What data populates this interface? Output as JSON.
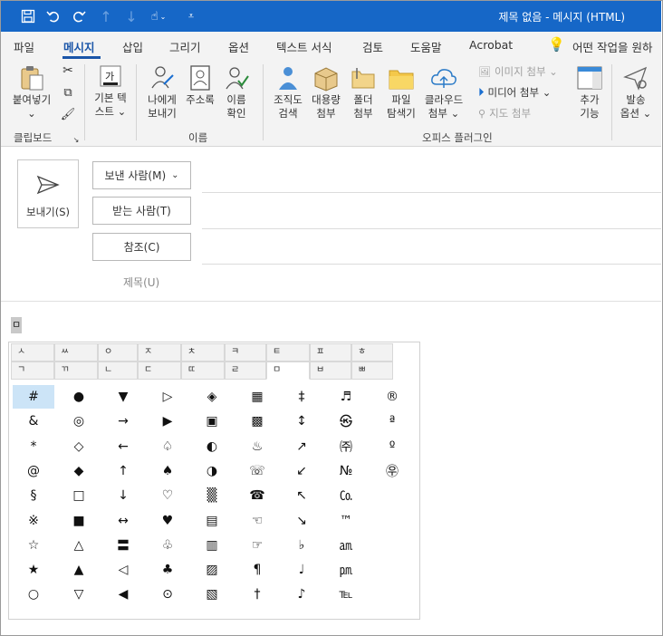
{
  "titlebar": {
    "title": "제목 없음  -  메시지 (HTML)",
    "icons": [
      "save-icon",
      "undo-icon",
      "redo-icon",
      "up-arrow-icon",
      "down-arrow-icon",
      "touch-mode-icon",
      "customize-quick-access-icon"
    ]
  },
  "tabs": [
    "파일",
    "메시지",
    "삽입",
    "그리기",
    "옵션",
    "텍스트 서식",
    "검토",
    "도움말",
    "Acrobat",
    "어떤 작업을 원하"
  ],
  "active_tab": "메시지",
  "ribbon": {
    "paste": {
      "line1": "붙여넣기",
      "line2": "⌄"
    },
    "clipboard_label": "클립보드",
    "basic_text": {
      "line1": "기본 텍",
      "line2": "스트 ⌄"
    },
    "assign_to_me": {
      "line1": "나에게",
      "line2": "보내기"
    },
    "address_book": {
      "line1": "주소록"
    },
    "check_names": {
      "line1": "이름",
      "line2": "확인"
    },
    "names_label": "이름",
    "org_search": {
      "line1": "조직도",
      "line2": "검색"
    },
    "large_attach": {
      "line1": "대용량",
      "line2": "첨부"
    },
    "folder_attach": {
      "line1": "폴더",
      "line2": "첨부"
    },
    "file_explorer": {
      "line1": "파일",
      "line2": "탐색기"
    },
    "cloud_attach": {
      "line1": "클라우드",
      "line2": "첨부 ⌄"
    },
    "image_attach": "이미지 첨부 ⌄",
    "media_attach": "미디어 첨부 ⌄",
    "map_attach": "지도 첨부",
    "add_feature": {
      "line1": "추가",
      "line2": "기능"
    },
    "send_options": {
      "line1": "발송",
      "line2": "옵션 ⌄"
    },
    "office_plugin_label": "오피스 플러그인"
  },
  "compose": {
    "send": "보내기(S)",
    "from": "보낸 사람(M)",
    "to": "받는 사람(T)",
    "cc": "참조(C)",
    "subject": "제목(U)"
  },
  "body": {
    "typed_char": "ㅁ"
  },
  "picker": {
    "tabs_row1": [
      "ㅅ",
      "ㅆ",
      "ㅇ",
      "ㅈ",
      "ㅊ",
      "ㅋ",
      "ㅌ",
      "ㅍ",
      "ㅎ"
    ],
    "tabs_row2": [
      "ㄱ",
      "ㄲ",
      "ㄴ",
      "ㄷ",
      "ㄸ",
      "ㄹ",
      "ㅁ",
      "ㅂ",
      "ㅃ"
    ],
    "selected_tab": "ㅁ",
    "columns": [
      [
        "#",
        "&",
        "*",
        "@",
        "§",
        "※",
        "☆",
        "★",
        "○"
      ],
      [
        "●",
        "◎",
        "◇",
        "◆",
        "□",
        "■",
        "△",
        "▲",
        "▽"
      ],
      [
        "▼",
        "→",
        "←",
        "↑",
        "↓",
        "↔",
        "〓",
        "◁",
        "◀"
      ],
      [
        "▷",
        "▶",
        "♤",
        "♠",
        "♡",
        "♥",
        "♧",
        "♣",
        "⊙"
      ],
      [
        "◈",
        "▣",
        "◐",
        "◑",
        "▒",
        "▤",
        "▥",
        "▨",
        "▧"
      ],
      [
        "▦",
        "▩",
        "♨",
        "☏",
        "☎",
        "☜",
        "☞",
        "¶",
        "†"
      ],
      [
        "‡",
        "↕",
        "↗",
        "↙",
        "↖",
        "↘",
        "♭",
        "♩",
        "♪"
      ],
      [
        "♬",
        "㉿",
        "㈜",
        "№",
        "㏇",
        "™",
        "㏂",
        "㏘",
        "℡"
      ],
      [
        "®",
        "ª",
        "º",
        "㉾",
        "",
        "",
        "",
        "",
        ""
      ]
    ],
    "highlighted": "#"
  }
}
